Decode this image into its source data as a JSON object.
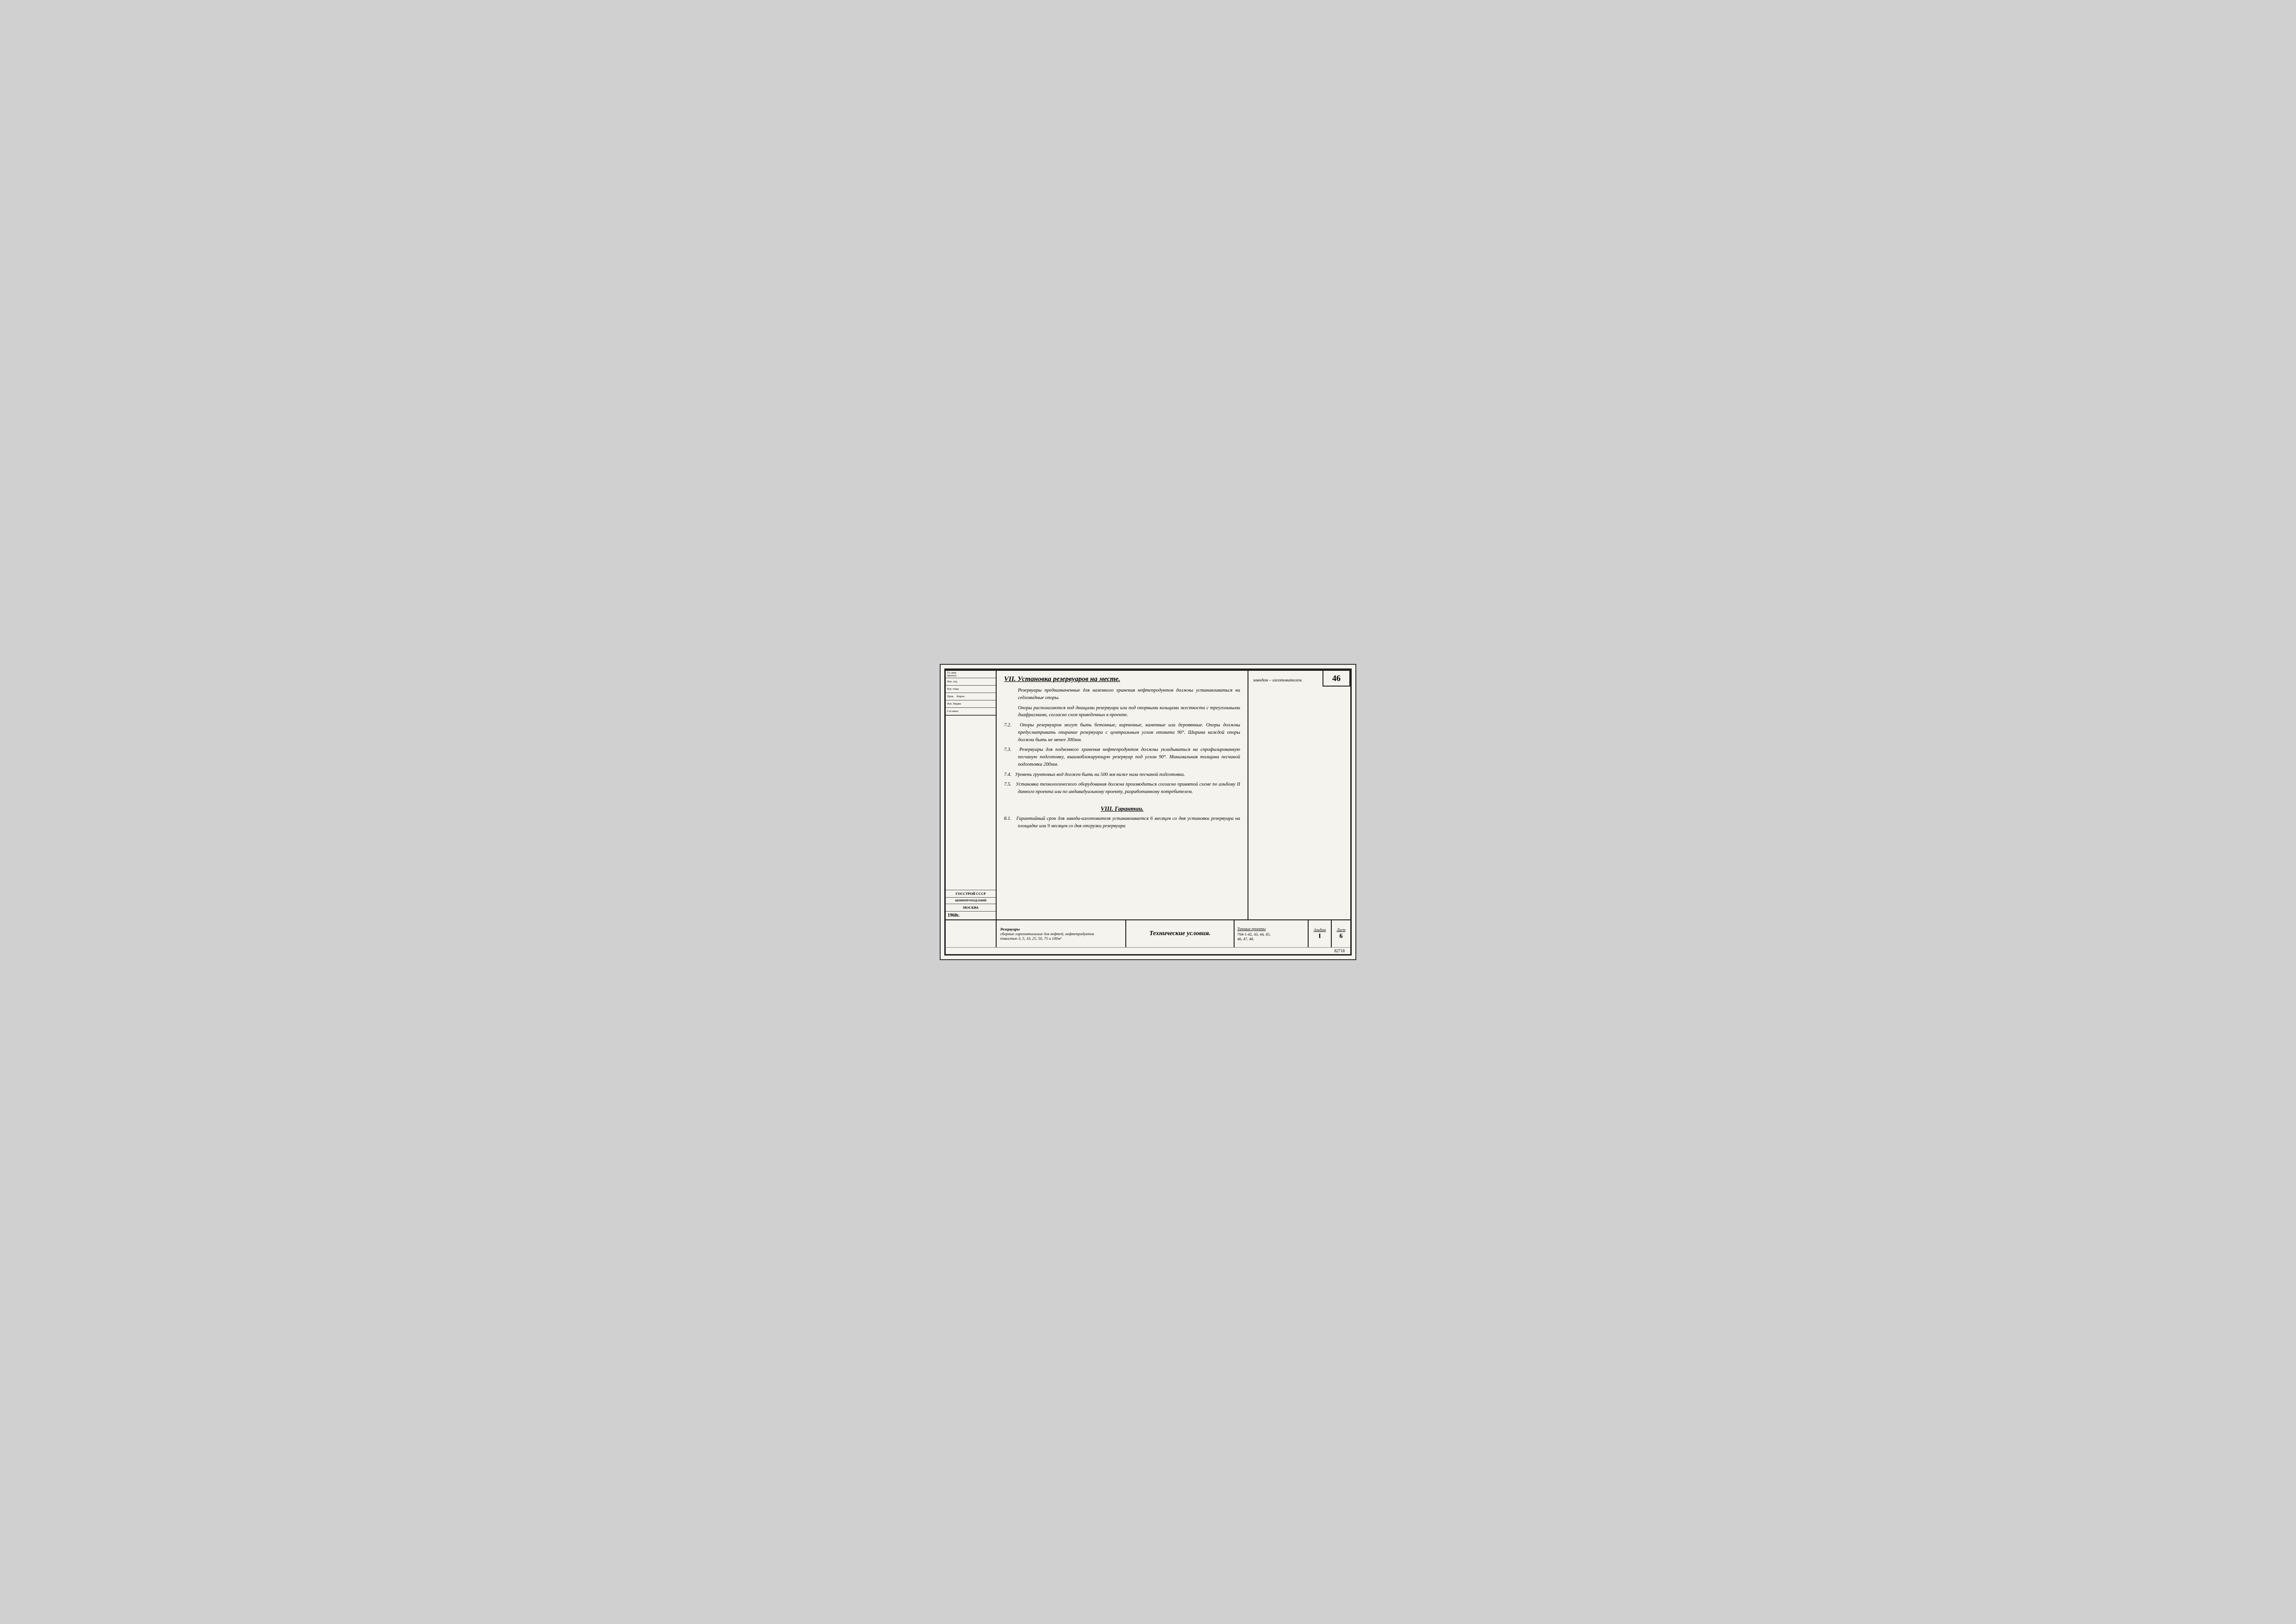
{
  "page": {
    "page_number": "46",
    "document_number": "82718"
  },
  "header": {
    "section7_title": "VII. Установка резервуаров на месте.",
    "section8_title": "VIII. Гарантии."
  },
  "section7": {
    "para_intro": "Резервуары предназначенные для наземного хранения нефтепродуктов должны устанавливаться на седловидные опоры.",
    "para_supports": "Опоры располагаются под днищами резервуара или под опорными кольцами жесткости с треугольными диафрагмами, согласно схем приведенных в проекте.",
    "para_7_2_num": "7.2.",
    "para_7_2": "Опоры резервуаров могут быть бетонные, кирпичные, каменные или деревянные. Опоры должны предусматривать опирание резервуара с центральным углом отхвата 90°. Ширина каждой опоры должна быть не менее 300мм.",
    "para_7_3_num": "7.3.",
    "para_7_3": "Резервуары для подземного хранения нефтепродуктов должны укладываться на спрофилированную песчаную подготовку, взаимоблокирующую резервуар под углом 90°. Минимальная толщина песчаной подготовки 200мм.",
    "para_7_4_num": "7.4.",
    "para_7_4": "Уровень грунтовых вод должен быть на 500 мм ниже низа песчаной подготовки.",
    "para_7_5_num": "7.5.",
    "para_7_5": "Установка технологического оборудования должна производиться согласно принятой схеме по альбому II данного проекта или по индивидуальному проекту, разработанному потребителем."
  },
  "section8": {
    "para_8_1_num": "8.1.",
    "para_8_1": "Гарантийный срок для завода-изготовителя устанавливается 6 месяцев со дня установки резервуара на площадке или 9 месяцев со дня отгрузки резервуара"
  },
  "right_panel": {
    "text": "заводом – изготовителем."
  },
  "footer": {
    "description_line1": "Резервуары",
    "description_line2": "сборные горизонтальные для нефтей, нефтепродуктов",
    "description_line3": "ёмкостью 3, 5, 10, 25, 50, 75 и 100м³",
    "title": "Технические условия.",
    "standards": "Типовые проекты 704-1-42, 43, 44, 45, 46, 47, 48.",
    "standards_label": "Типовые проекты",
    "standards_numbers": "704-1-42, 43, 44, 45,",
    "standards_numbers2": "46, 47, 48.",
    "album_label": "Альбом",
    "album_value": "I",
    "sheet_label": "Лист",
    "sheet_value": "6"
  },
  "sidebar": {
    "org1": "ГОССТРОЙ СССР",
    "org2": "ЦНИИПРОМЗДАНИЙ",
    "org3": "МОСКВА",
    "year": "1968г.",
    "roles": [
      {
        "label": "Гл. инженер проекта"
      },
      {
        "label": "Нач. отдела"
      },
      {
        "label": "Рук. темы"
      },
      {
        "label": "Пров. Корин"
      },
      {
        "label": "Пров. Нач Марин"
      },
      {
        "label": "Составил"
      }
    ]
  }
}
